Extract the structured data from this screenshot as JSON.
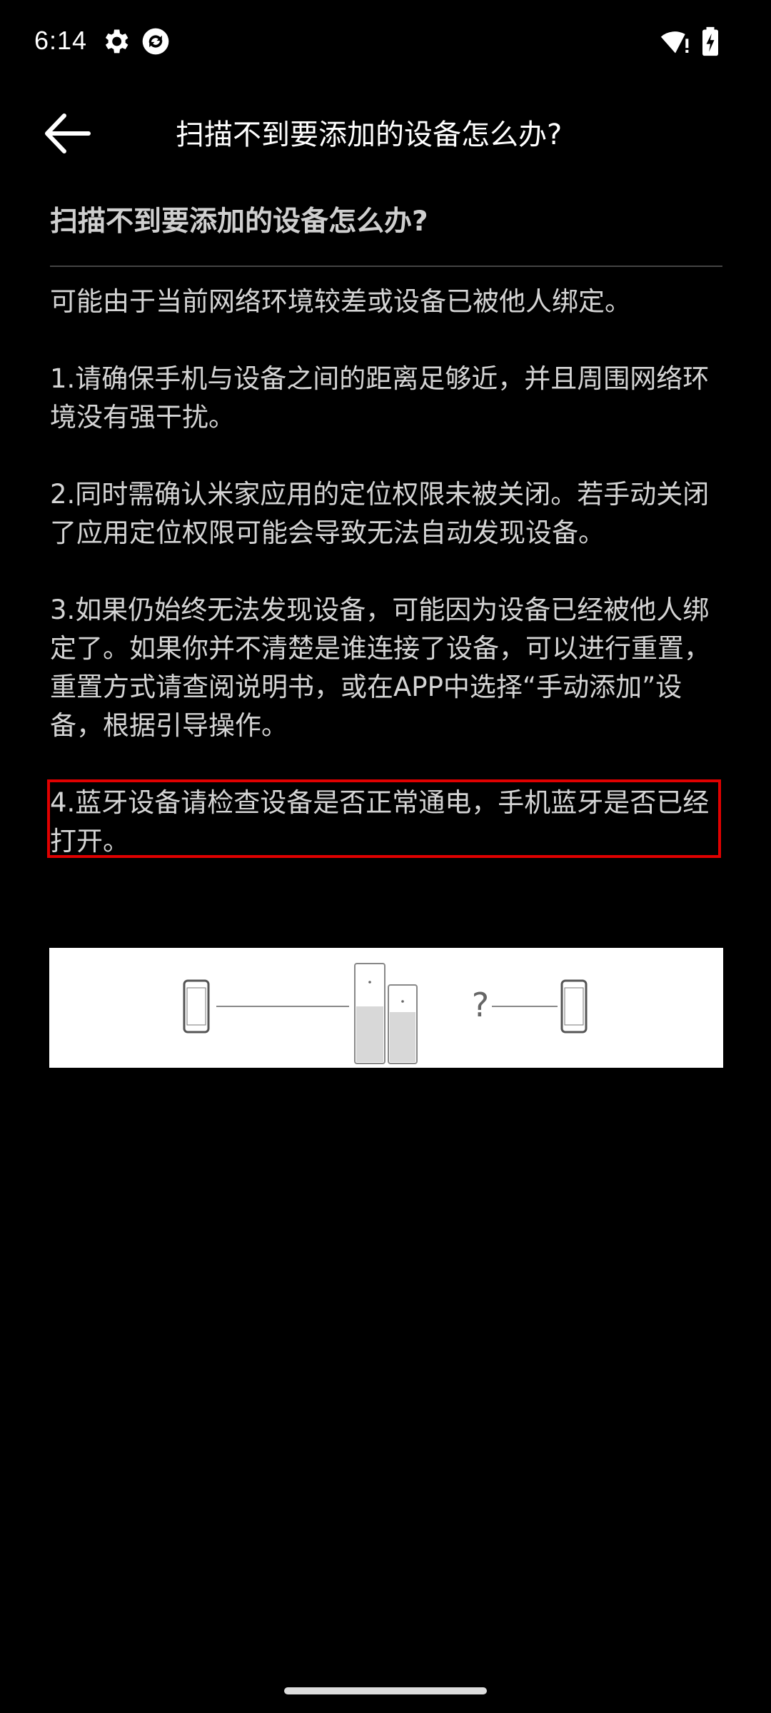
{
  "status_bar": {
    "time": "6:14",
    "icons": [
      "gear-icon",
      "sync-app-icon",
      "wifi-alert-icon",
      "battery-charging-icon"
    ]
  },
  "app_bar": {
    "back_icon": "arrow-left-icon",
    "title": "扫描不到要添加的设备怎么办?"
  },
  "article": {
    "title": "扫描不到要添加的设备怎么办?",
    "intro": "可能由于当前网络环境较差或设备已被他人绑定。",
    "steps": [
      "1.请确保手机与设备之间的距离足够近，并且周围网络环境没有强干扰。",
      "2.同时需确认米家应用的定位权限未被关闭。若手动关闭了应用定位权限可能会导致无法自动发现设备。",
      "3.如果仍始终无法发现设备，可能因为设备已经被他人绑定了。如果你并不清楚是谁连接了设备，可以进行重置，重置方式请查阅说明书，或在APP中选择“手动添加”设备，根据引导操作。",
      "4.蓝牙设备请检查设备是否正常通电，手机蓝牙是否已经打开。"
    ],
    "illustration": {
      "question_mark": "?",
      "icons": [
        "phone-icon",
        "router-icon",
        "phone-icon"
      ]
    }
  },
  "colors": {
    "background": "#000000",
    "text": "#d4d4d4",
    "highlight": "#e00000"
  }
}
